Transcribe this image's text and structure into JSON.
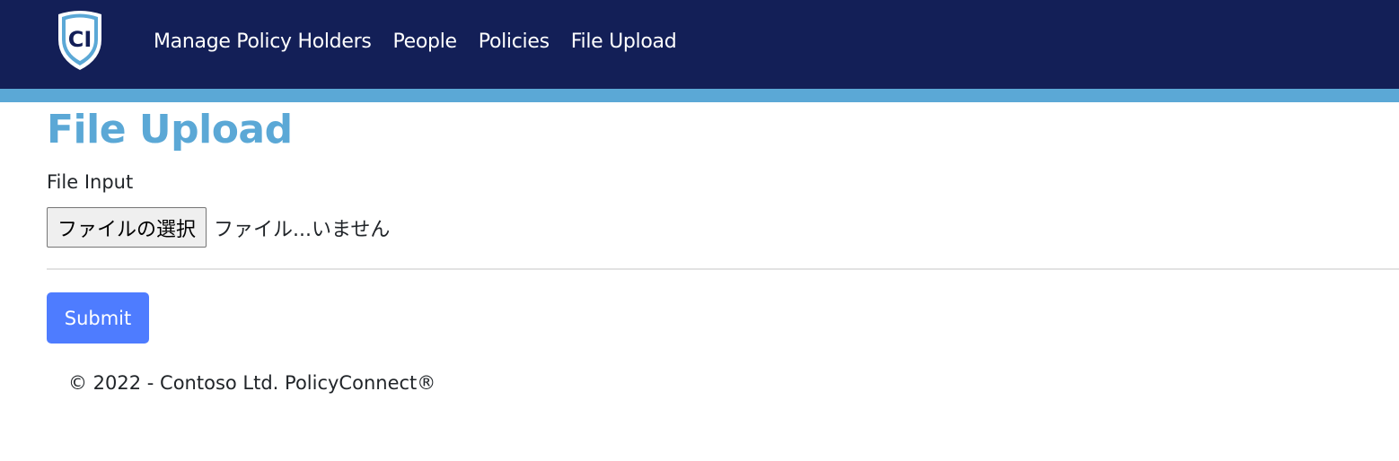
{
  "navbar": {
    "logo_text": "CI",
    "links": [
      {
        "label": "Manage Policy Holders"
      },
      {
        "label": "People"
      },
      {
        "label": "Policies"
      },
      {
        "label": "File Upload"
      }
    ]
  },
  "main": {
    "title": "File Upload",
    "file_input": {
      "label": "File Input",
      "button_label": "ファイルの選択",
      "status_text": "ファイル...いません"
    },
    "submit_label": "Submit"
  },
  "footer": {
    "text": "© 2022 - Contoso Ltd. PolicyConnect®"
  },
  "colors": {
    "navbar_bg": "#131f57",
    "accent": "#5ba8d6",
    "primary_button": "#4e7cff"
  },
  "icons": {
    "logo": "shield-logo-icon"
  }
}
